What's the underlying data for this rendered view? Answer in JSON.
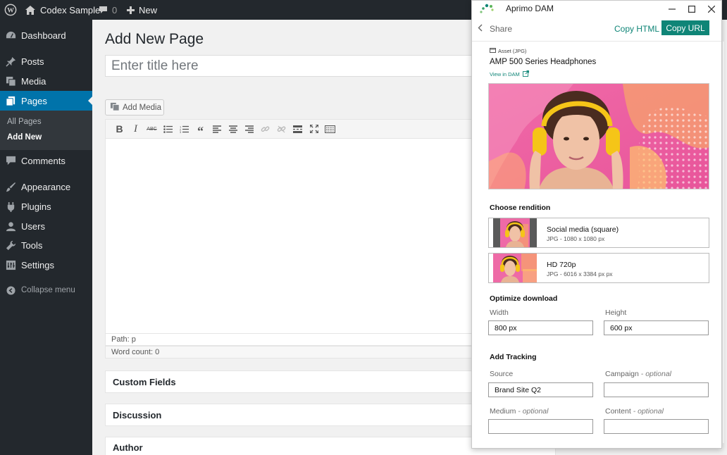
{
  "adminbar": {
    "site_name": "Codex Sample",
    "comments_count": "0",
    "new_label": "New"
  },
  "sidebar": {
    "items": [
      {
        "label": "Dashboard",
        "icon": "dashboard-icon"
      },
      {
        "label": "Posts",
        "icon": "pin-icon"
      },
      {
        "label": "Media",
        "icon": "media-icon"
      },
      {
        "label": "Pages",
        "icon": "pages-icon"
      },
      {
        "label": "Comments",
        "icon": "comment-icon"
      },
      {
        "label": "Appearance",
        "icon": "paintbrush-icon"
      },
      {
        "label": "Plugins",
        "icon": "plug-icon"
      },
      {
        "label": "Users",
        "icon": "users-icon"
      },
      {
        "label": "Tools",
        "icon": "wrench-icon"
      },
      {
        "label": "Settings",
        "icon": "settings-icon"
      }
    ],
    "submenu": [
      "All Pages",
      "Add New"
    ],
    "collapse_label": "Collapse menu"
  },
  "editor": {
    "page_title": "Add New Page",
    "title_placeholder": "Enter title here",
    "add_media_label": "Add Media",
    "path_label": "Path: p",
    "word_count": "Word count: 0",
    "toolbar_icons": [
      "bold-icon",
      "italic-icon",
      "strikethrough-icon",
      "bullet-list-icon",
      "numbered-list-icon",
      "blockquote-icon",
      "align-left-icon",
      "align-center-icon",
      "align-right-icon",
      "link-icon",
      "unlink-icon",
      "read-more-icon",
      "fullscreen-icon",
      "toolbar-toggle-icon"
    ]
  },
  "postboxes": [
    "Custom Fields",
    "Discussion",
    "Author"
  ],
  "dam": {
    "window_title": "Aprimo DAM",
    "share_label": "Share",
    "copy_html_label": "Copy HTML",
    "copy_url_label": "Copy URL",
    "asset_type": "Asset (JPG)",
    "asset_name": "AMP 500 Series Headphones",
    "view_in_dam": "View in DAM",
    "choose_rendition": "Choose rendition",
    "renditions": [
      {
        "name": "Social media (square)",
        "desc": "JPG - 1080 x 1080 px"
      },
      {
        "name": "HD 720p",
        "desc": "JPG - 6016 x 3384 px px"
      }
    ],
    "optimize_title": "Optimize download",
    "width_label": "Width",
    "width_value": "800 px",
    "height_label": "Height",
    "height_value": "600 px",
    "tracking_title": "Add Tracking",
    "source_label": "Source",
    "source_value": "Brand Site Q2",
    "campaign_label": "Campaign",
    "medium_label": "Medium",
    "content_label": "Content",
    "optional_label": "- optional",
    "accent_color": "#0f8577"
  }
}
